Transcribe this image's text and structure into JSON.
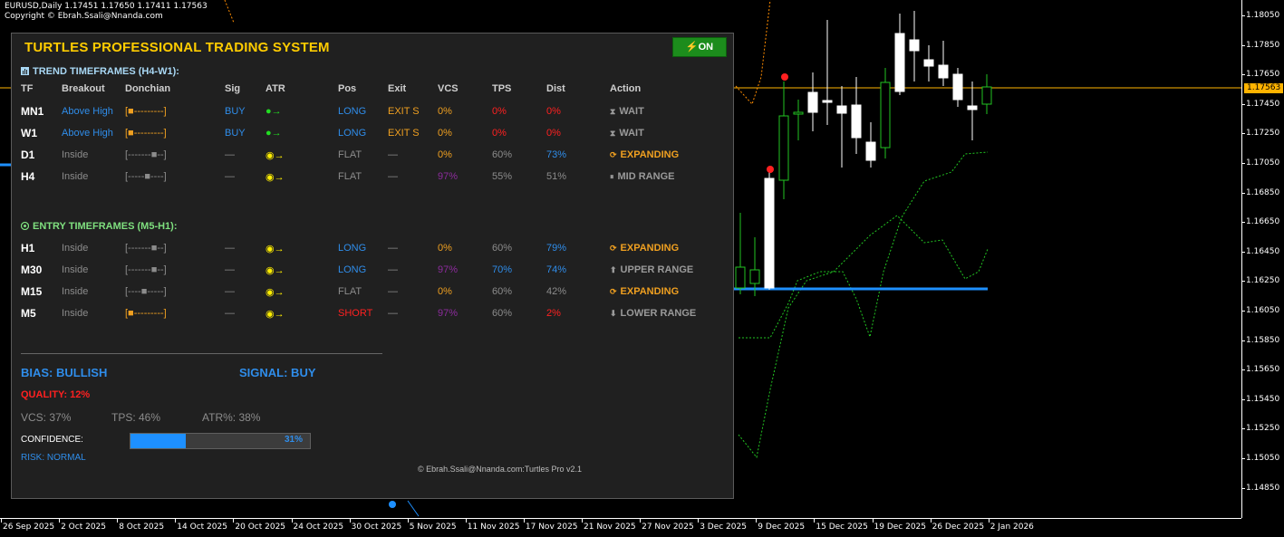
{
  "chart": {
    "header_line1": "EURUSD,Daily  1.17451 1.17650 1.17411 1.17563",
    "header_line2": "Copyright © Ebrah.Ssali@Nnanda.com",
    "current_price": "1.17563",
    "price_labels": [
      "1.18050",
      "1.17850",
      "1.17650",
      "1.17450",
      "1.17250",
      "1.17050",
      "1.16850",
      "1.16650",
      "1.16450",
      "1.16250",
      "1.16050",
      "1.15850",
      "1.15650",
      "1.15450",
      "1.15250",
      "1.15050",
      "1.14850"
    ],
    "date_labels": [
      "26 Sep 2025",
      "2 Oct 2025",
      "8 Oct 2025",
      "14 Oct 2025",
      "20 Oct 2025",
      "24 Oct 2025",
      "30 Oct 2025",
      "5 Nov 2025",
      "11 Nov 2025",
      "17 Nov 2025",
      "21 Nov 2025",
      "27 Nov 2025",
      "3 Dec 2025",
      "9 Dec 2025",
      "15 Dec 2025",
      "19 Dec 2025",
      "26 Dec 2025",
      "2 Jan 2026"
    ],
    "colors": {
      "bull": "#22c522",
      "bear": "#ffffff",
      "price_line": "#ffb300",
      "level_line": "#1e90ff",
      "dotted_green": "#22c522",
      "dotted_orange": "#ff8c00",
      "marker_red": "#ff2020"
    }
  },
  "panel": {
    "title": "TURTLES PROFESSIONAL TRADING SYSTEM",
    "on_button": "ON",
    "trend_title": "TREND TIMEFRAMES (H4-W1):",
    "entry_title": "ENTRY TIMEFRAMES (M5-H1):",
    "headers": [
      "TF",
      "Breakout",
      "Donchian",
      "Sig",
      "ATR",
      "Pos",
      "Exit",
      "VCS",
      "TPS",
      "Dist",
      "Action"
    ],
    "trend_rows": [
      {
        "tf": "MN1",
        "breakout": "Above High",
        "donchian": "[■---------]",
        "sig": "BUY",
        "atr": "●→",
        "pos": "LONG",
        "exit": "EXIT S",
        "vcs": "0%",
        "tps": "0%",
        "dist": "0%",
        "action": "WAIT",
        "c_breakout": "blue",
        "c_donchian": "orange",
        "c_sig": "blue",
        "c_atr": "green",
        "c_pos": "blue",
        "c_exit": "orange",
        "c_vcs": "orange",
        "c_tps": "red",
        "c_dist": "red",
        "c_action": "dim",
        "action_icon": "hourglass-icon"
      },
      {
        "tf": "W1",
        "breakout": "Above High",
        "donchian": "[■---------]",
        "sig": "BUY",
        "atr": "●→",
        "pos": "LONG",
        "exit": "EXIT S",
        "vcs": "0%",
        "tps": "0%",
        "dist": "0%",
        "action": "WAIT",
        "c_breakout": "blue",
        "c_donchian": "orange",
        "c_sig": "blue",
        "c_atr": "green",
        "c_pos": "blue",
        "c_exit": "orange",
        "c_vcs": "orange",
        "c_tps": "red",
        "c_dist": "red",
        "c_action": "dim",
        "action_icon": "hourglass-icon"
      },
      {
        "tf": "D1",
        "breakout": "Inside",
        "donchian": "[-------■--]",
        "sig": "—",
        "atr": "◉→",
        "pos": "FLAT",
        "exit": "—",
        "vcs": "0%",
        "tps": "60%",
        "dist": "73%",
        "action": "EXPANDING",
        "c_breakout": "gray",
        "c_donchian": "gray",
        "c_sig": "gray",
        "c_atr": "yellow",
        "c_pos": "gray",
        "c_exit": "gray",
        "c_vcs": "orange",
        "c_tps": "gray",
        "c_dist": "blue",
        "c_action": "orange",
        "action_icon": "expand-icon"
      },
      {
        "tf": "H4",
        "breakout": "Inside",
        "donchian": "[-----■----]",
        "sig": "—",
        "atr": "◉→",
        "pos": "FLAT",
        "exit": "—",
        "vcs": "97%",
        "tps": "55%",
        "dist": "51%",
        "action": "MID RANGE",
        "c_breakout": "gray",
        "c_donchian": "gray",
        "c_sig": "gray",
        "c_atr": "yellow",
        "c_pos": "gray",
        "c_exit": "gray",
        "c_vcs": "purple",
        "c_tps": "gray",
        "c_dist": "gray",
        "c_action": "dim",
        "action_icon": "pause-icon"
      }
    ],
    "entry_rows": [
      {
        "tf": "H1",
        "breakout": "Inside",
        "donchian": "[-------■--]",
        "sig": "—",
        "atr": "◉→",
        "pos": "LONG",
        "exit": "—",
        "vcs": "0%",
        "tps": "60%",
        "dist": "79%",
        "action": "EXPANDING",
        "c_breakout": "gray",
        "c_donchian": "gray",
        "c_sig": "gray",
        "c_atr": "yellow",
        "c_pos": "blue",
        "c_exit": "gray",
        "c_vcs": "orange",
        "c_tps": "gray",
        "c_dist": "blue",
        "c_action": "orange",
        "action_icon": "expand-icon"
      },
      {
        "tf": "M30",
        "breakout": "Inside",
        "donchian": "[-------■--]",
        "sig": "—",
        "atr": "◉→",
        "pos": "LONG",
        "exit": "—",
        "vcs": "97%",
        "tps": "70%",
        "dist": "74%",
        "action": "UPPER RANGE",
        "c_breakout": "gray",
        "c_donchian": "gray",
        "c_sig": "gray",
        "c_atr": "yellow",
        "c_pos": "blue",
        "c_exit": "gray",
        "c_vcs": "purple",
        "c_tps": "blue",
        "c_dist": "blue",
        "c_action": "dim",
        "action_icon": "up-arrow-icon"
      },
      {
        "tf": "M15",
        "breakout": "Inside",
        "donchian": "[----■-----]",
        "sig": "—",
        "atr": "◉→",
        "pos": "FLAT",
        "exit": "—",
        "vcs": "0%",
        "tps": "60%",
        "dist": "42%",
        "action": "EXPANDING",
        "c_breakout": "gray",
        "c_donchian": "gray",
        "c_sig": "gray",
        "c_atr": "yellow",
        "c_pos": "gray",
        "c_exit": "gray",
        "c_vcs": "orange",
        "c_tps": "gray",
        "c_dist": "gray",
        "c_action": "orange",
        "action_icon": "expand-icon"
      },
      {
        "tf": "M5",
        "breakout": "Inside",
        "donchian": "[■---------]",
        "sig": "—",
        "atr": "◉→",
        "pos": "SHORT",
        "exit": "—",
        "vcs": "97%",
        "tps": "60%",
        "dist": "2%",
        "action": "LOWER RANGE",
        "c_breakout": "gray",
        "c_donchian": "orange",
        "c_sig": "gray",
        "c_atr": "yellow",
        "c_pos": "red",
        "c_exit": "gray",
        "c_vcs": "purple",
        "c_tps": "gray",
        "c_dist": "red",
        "c_action": "dim",
        "action_icon": "down-arrow-icon"
      }
    ],
    "bias": "BIAS: BULLISH",
    "signal": "SIGNAL: BUY",
    "quality": "QUALITY: 12%",
    "vcs": "VCS: 37%",
    "tps": "TPS: 46%",
    "atr": "ATR%: 38%",
    "confidence_label": "CONFIDENCE:",
    "confidence_value": 0.31,
    "confidence_text": "31%",
    "risk": "RISK: NORMAL",
    "footer": "© Ebrah.Ssali@Nnanda.com:Turtles Pro v2.1"
  }
}
